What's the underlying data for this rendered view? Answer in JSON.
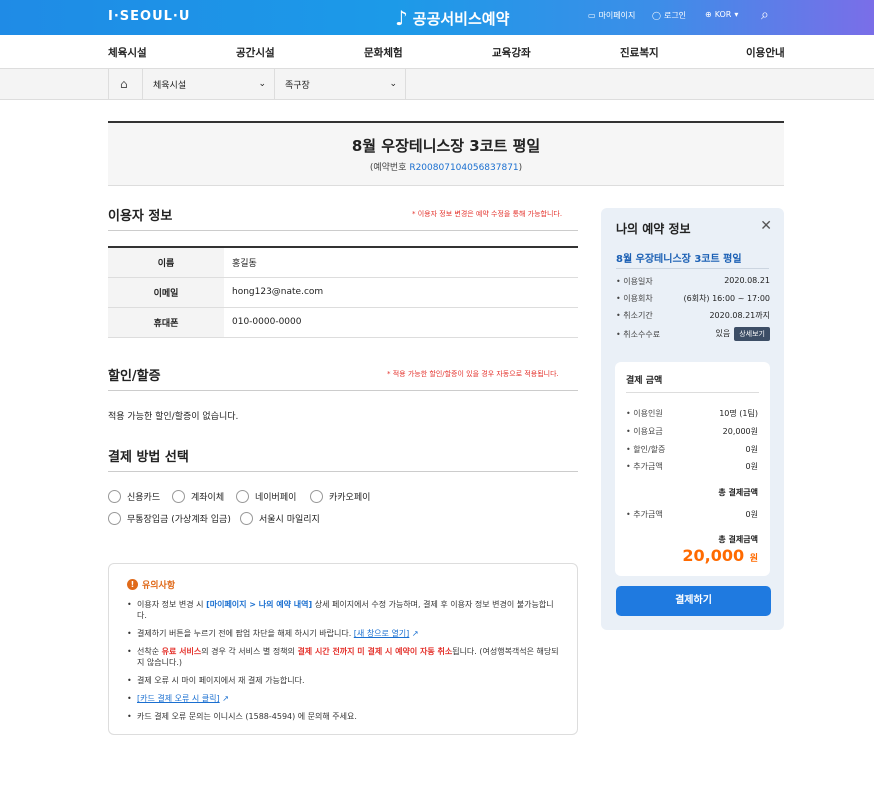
{
  "header": {
    "logo": "I·SEOUL·U",
    "brand": "공공서비스예약",
    "mypage": "마이페이지",
    "login": "로그인",
    "lang": "KOR"
  },
  "gnb": [
    "체육시설",
    "공간시설",
    "문화체험",
    "교육강좌",
    "진료복지",
    "이용안내"
  ],
  "crumb": {
    "level1": "체육시설",
    "level2": "족구장"
  },
  "booking": {
    "title": "8월 우장테니스장 3코트 평일",
    "number_label": "(예약번호 ",
    "number": "R200807104056837871",
    "number_end": ")"
  },
  "user": {
    "title": "이용자 정보",
    "note": "* 이용자 정보 변경은 예약 수정을 통해 가능합니다.",
    "rows": [
      {
        "k": "이름",
        "v": "홍길동"
      },
      {
        "k": "이메일",
        "v": "hong123@nate.com"
      },
      {
        "k": "휴대폰",
        "v": "010-0000-0000"
      }
    ]
  },
  "discount": {
    "title": "할인/할증",
    "note": "* 적용 가능한 할인/할증이 있을 경우 자동으로 적용됩니다.",
    "text": "적용 가능한 할인/할증이 없습니다."
  },
  "payment": {
    "title": "결제 방법 선택",
    "options": [
      "신용카드",
      "계좌이체",
      "네이버페이",
      "카카오페이",
      "무통장입금 (가상계좌 입금)",
      "서울시 마일리지"
    ]
  },
  "notice": {
    "title": "유의사항",
    "r1a": "이용자 정보 변경 시 ",
    "r1b": "[마이페이지 > 나의 예약 내역]",
    "r1c": " 상세 페이지에서 수정 가능하며, 결제 후 이용자 정보 변경이 불가능합니다.",
    "r2a": "결제하기 버튼을 누르기 전에 팝업 차단을 해제 하시기 바랍니다. ",
    "r2b": "[새 창으로 열기]",
    "r3a": "선착순 ",
    "r3b": "유료 서비스",
    "r3c": "의 경우 각 서비스 별 정책의 ",
    "r3d": "결제 시간 전까지 미 결제 시 예약이 자동 취소",
    "r3e": "됩니다. (여성행복객석은 해당되지 않습니다.)",
    "r4": "결제 오류 시 마이 페이지에서 재 결제 가능합니다.",
    "r5": "[카드 결제 오류 시 클릭]",
    "r6": "카드 결제 오류 문의는 이니시스 (1588-4594) 에 문의해 주세요."
  },
  "side": {
    "title": "나의 예약 정보",
    "name": "8월 우장테니스장 3코트 평일",
    "info": [
      {
        "k": "이용일자",
        "v": "2020.08.21"
      },
      {
        "k": "이용회차",
        "v": "(6회차) 16:00 ~ 17:00"
      },
      {
        "k": "취소기간",
        "v": "2020.08.21까지"
      },
      {
        "k": "취소수수료",
        "v": "있음"
      }
    ],
    "detail_btn": "상세보기",
    "pay_title": "결제 금액",
    "pay": [
      {
        "k": "이용인원",
        "v": "10명 (1팀)"
      },
      {
        "k": "이용요금",
        "v": "20,000원"
      },
      {
        "k": "할인/할증",
        "v": "0원"
      },
      {
        "k": "추가금액",
        "v": "0원"
      }
    ],
    "total_ghost": "총 결제금액",
    "ghost_k": "추가금액",
    "ghost_v": "0원",
    "total_label": "총 결제금액",
    "total": "20,000",
    "won": "원",
    "button": "결제하기"
  }
}
